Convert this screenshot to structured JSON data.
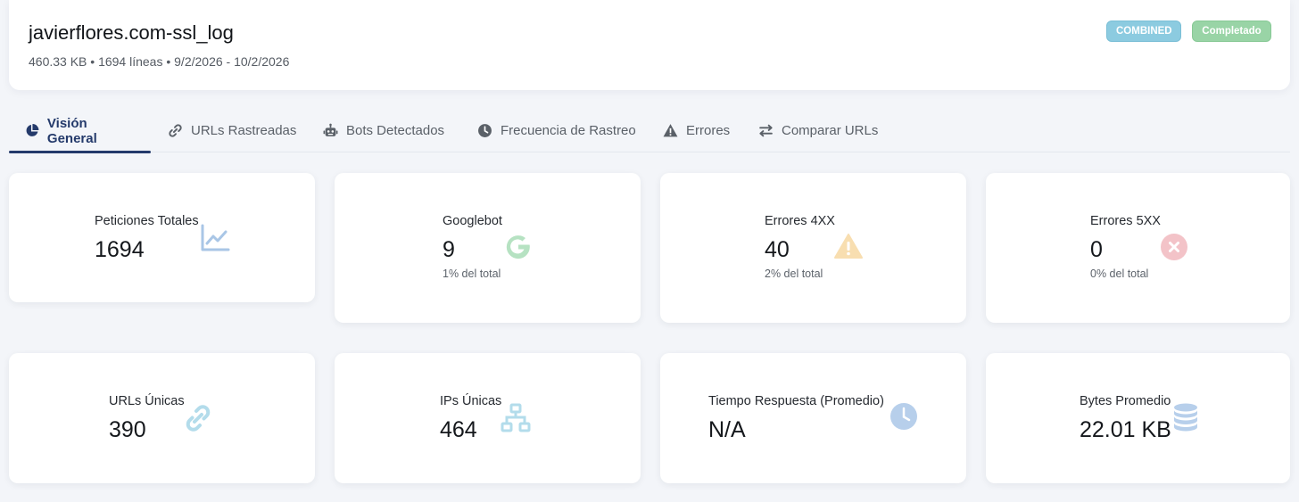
{
  "header": {
    "title": "javierflores.com-ssl_log",
    "meta": "460.33 KB • 1694 líneas • 9/2/2026 - 10/2/2026",
    "badges": {
      "format": "COMBINED",
      "status": "Completado"
    }
  },
  "tabs": [
    {
      "label": "Visión General",
      "icon": "pie-chart-icon",
      "active": true
    },
    {
      "label": "URLs Rastreadas",
      "icon": "link-icon"
    },
    {
      "label": "Bots Detectados",
      "icon": "robot-icon"
    },
    {
      "label": "Frecuencia de Rastreo",
      "icon": "clock-icon"
    },
    {
      "label": "Errores",
      "icon": "warning-icon"
    },
    {
      "label": "Comparar URLs",
      "icon": "exchange-icon"
    }
  ],
  "stats": [
    {
      "label": "Peticiones Totales",
      "value": "1694",
      "icon": "line-chart-icon",
      "color": "#a9c6e6"
    },
    {
      "label": "Googlebot",
      "value": "9",
      "sub": "1% del total",
      "icon": "google-icon",
      "color": "#b6e2c2"
    },
    {
      "label": "Errores 4XX",
      "value": "40",
      "sub": "2% del total",
      "icon": "warning-icon",
      "color": "#f8deb0"
    },
    {
      "label": "Errores 5XX",
      "value": "0",
      "sub": "0% del total",
      "icon": "times-circle-icon",
      "color": "#f3c3c8"
    },
    {
      "label": "URLs Únicas",
      "value": "390",
      "icon": "link-icon",
      "color": "#b3dceb"
    },
    {
      "label": "IPs Únicas",
      "value": "464",
      "icon": "network-icon",
      "color": "#b3dceb"
    },
    {
      "label": "Tiempo Respuesta (Promedio)",
      "value": "N/A",
      "icon": "clock-icon",
      "color": "#b7cfeb"
    },
    {
      "label": "Bytes Promedio",
      "value": "22.01 KB",
      "icon": "database-icon",
      "color": "#b7cfeb"
    }
  ],
  "colors": {
    "accent": "#243a6b",
    "combined_badge": "#8ccbe0",
    "status_badge": "#99d4a6"
  }
}
